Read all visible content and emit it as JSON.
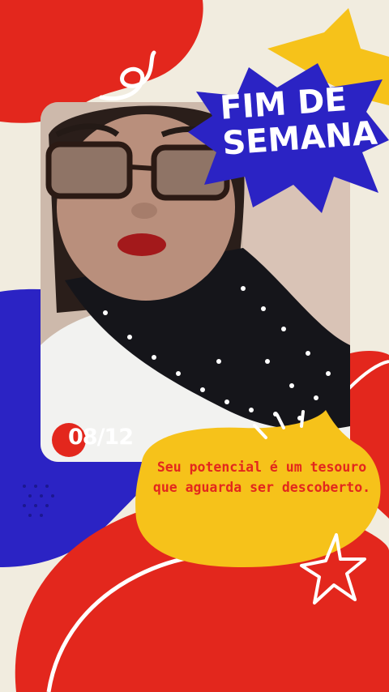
{
  "headline": {
    "line1": "FIM DE",
    "line2": "SEMANA"
  },
  "counter": {
    "text": "08/12"
  },
  "quote": {
    "line1": "Seu potencial é um tesouro",
    "line2": "que aguarda ser descoberto."
  },
  "colors": {
    "background": "#f1ecdf",
    "red": "#e3271d",
    "blue": "#2b23c4",
    "yellow": "#f6c21a",
    "white": "#ffffff"
  }
}
